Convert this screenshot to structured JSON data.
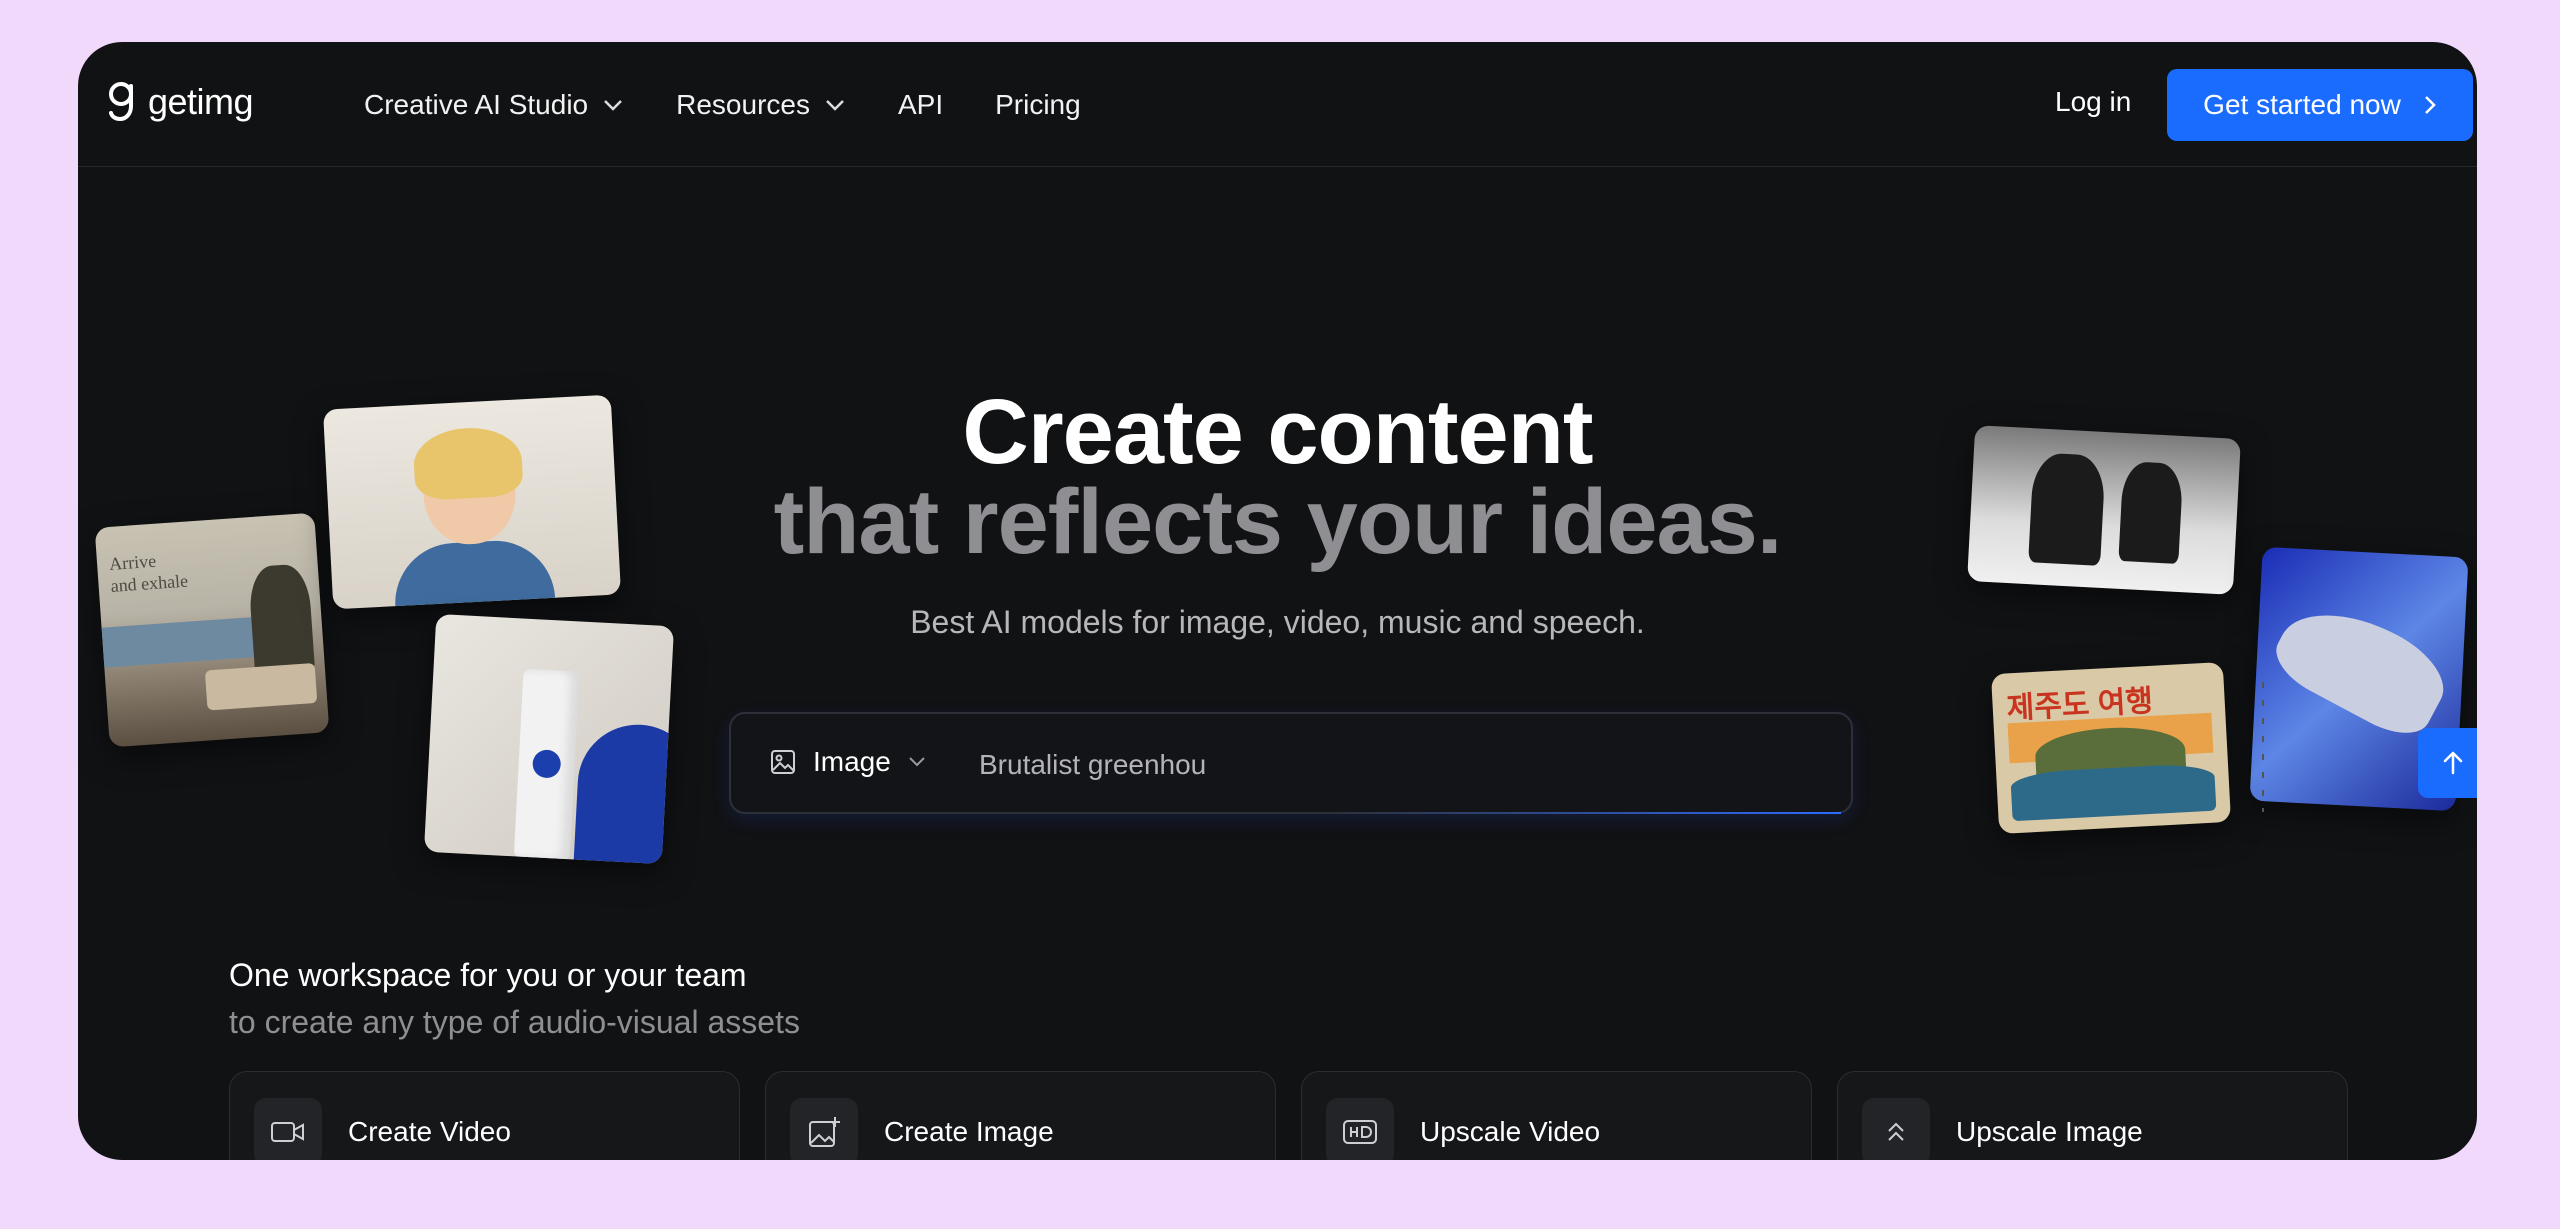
{
  "brand": {
    "name": "getimg"
  },
  "nav": {
    "items": [
      {
        "label": "Creative AI Studio",
        "has_dropdown": true
      },
      {
        "label": "Resources",
        "has_dropdown": true
      },
      {
        "label": "API",
        "has_dropdown": false
      },
      {
        "label": "Pricing",
        "has_dropdown": false
      }
    ],
    "login_label": "Log in",
    "cta_label": "Get started now"
  },
  "hero": {
    "title_line1": "Create content",
    "title_line2": "that reflects your ideas.",
    "subtitle": "Best AI models for image, video, music and speech."
  },
  "prompt": {
    "type_label": "Image",
    "value": "Brutalist greenhou"
  },
  "gallery": {
    "card_interior_text": "Arrive\nand exhale",
    "card_jeju_text": "제주도 여행"
  },
  "workspace": {
    "title": "One workspace for you or your team",
    "subtitle": "to create any type of audio-visual assets",
    "tiles": [
      {
        "label": "Create Video",
        "icon": "video-camera-icon"
      },
      {
        "label": "Create Image",
        "icon": "image-plus-icon"
      },
      {
        "label": "Upscale Video",
        "icon": "hd-icon"
      },
      {
        "label": "Upscale Image",
        "icon": "chevrons-up-icon"
      }
    ]
  },
  "colors": {
    "page_bg": "#f0d9fb",
    "window_bg": "#111214",
    "accent": "#1a6cff",
    "text_primary": "#ffffff",
    "text_secondary": "#8f8f93"
  }
}
